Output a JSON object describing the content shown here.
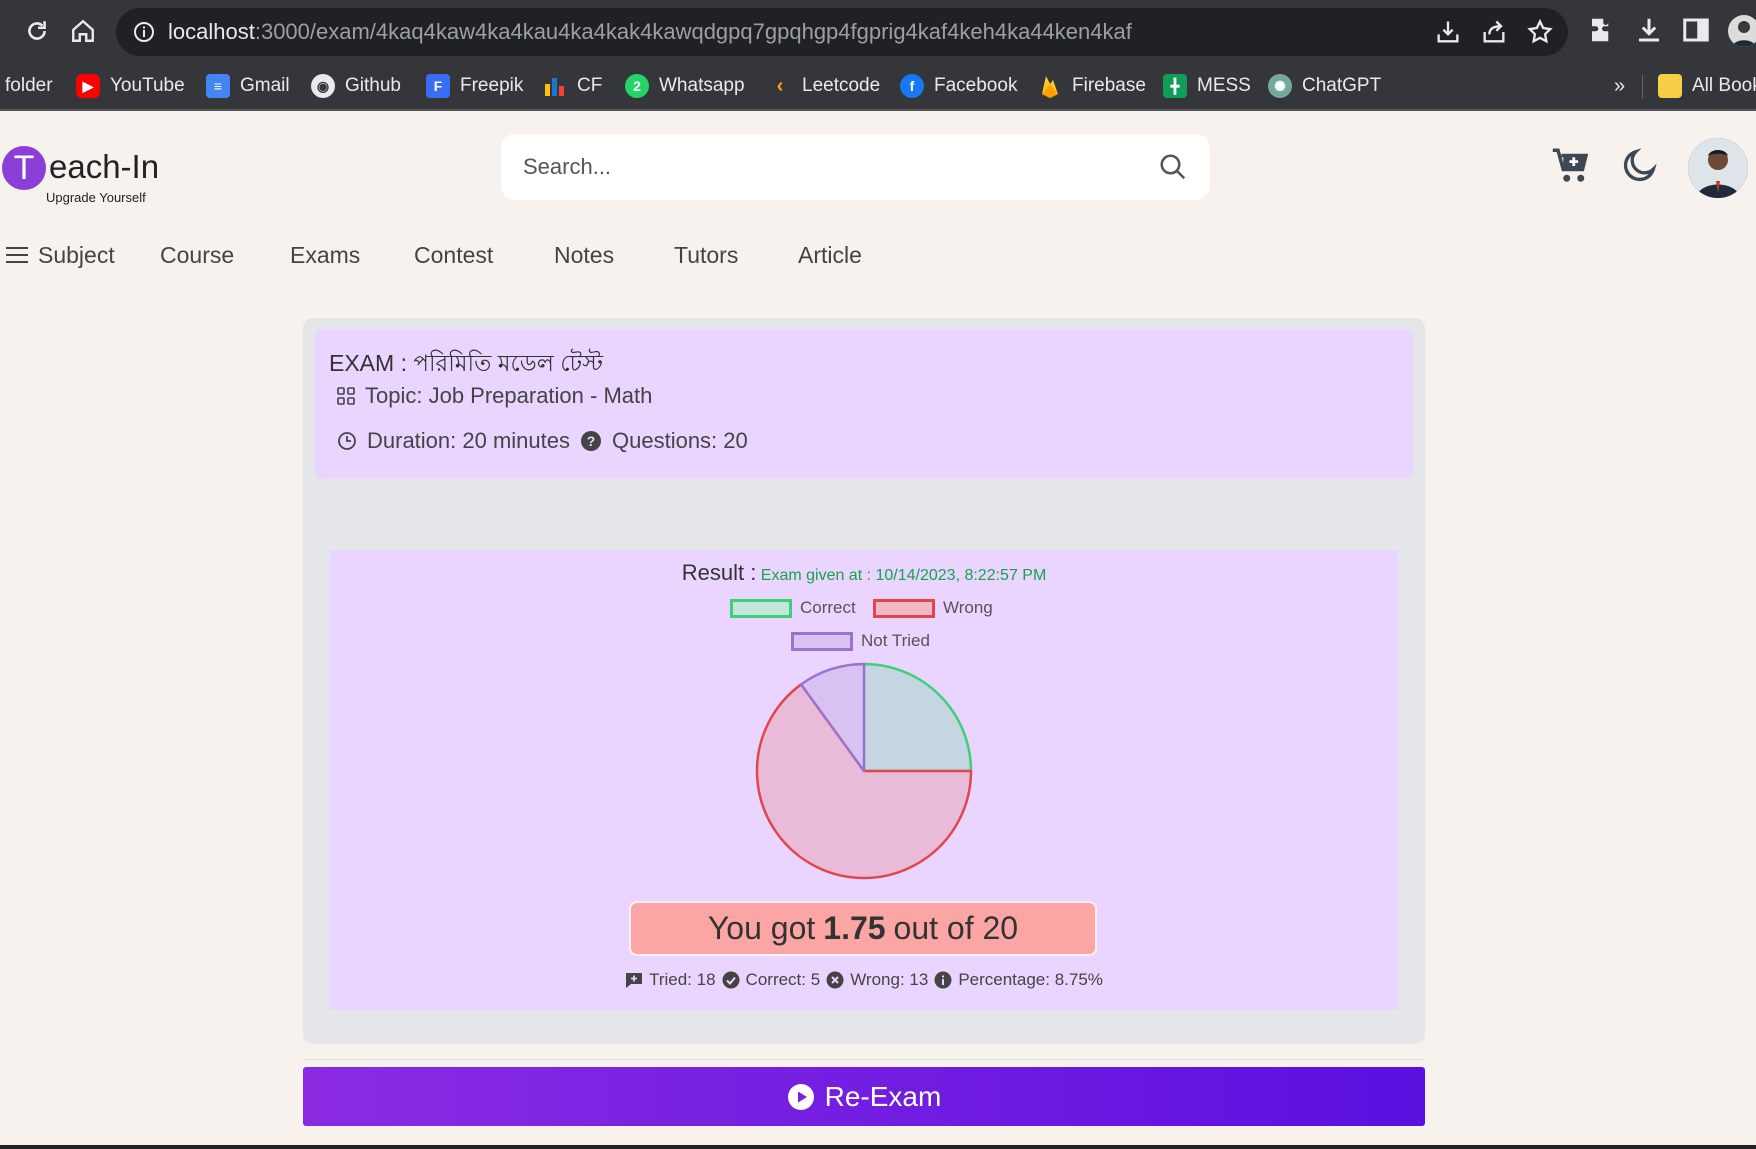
{
  "browser": {
    "url_host": "localhost",
    "url_path": ":3000/exam/4kaq4kaw4ka4kau4ka4kak4kawqdgpq7gpqhgp4fgprig4kaf4keh4ka44ken4kaf",
    "bookmarks": [
      {
        "label": "folder",
        "icon": "folder-icon"
      },
      {
        "label": "YouTube",
        "icon": "youtube-icon",
        "color": "#ff0000"
      },
      {
        "label": "Gmail",
        "icon": "docs-icon",
        "color": "#4285f4"
      },
      {
        "label": "Github",
        "icon": "github-icon",
        "color": "#e8eaed"
      },
      {
        "label": "Freepik",
        "icon": "freepik-icon",
        "color": "#3b6cf6"
      },
      {
        "label": "CF",
        "icon": "codeforces-icon"
      },
      {
        "label": "Whatsapp",
        "icon": "whatsapp-icon",
        "color": "#25d366"
      },
      {
        "label": "Leetcode",
        "icon": "leetcode-icon",
        "color": "#ffa116"
      },
      {
        "label": "Facebook",
        "icon": "facebook-icon",
        "color": "#1877f2"
      },
      {
        "label": "Firebase",
        "icon": "firebase-icon",
        "color": "#ffca28"
      },
      {
        "label": "MESS",
        "icon": "sheets-icon",
        "color": "#0f9d58"
      },
      {
        "label": "ChatGPT",
        "icon": "chatgpt-icon",
        "color": "#74aa9c"
      }
    ],
    "more_bookmarks": "»",
    "all_bookmarks": "All Book"
  },
  "site": {
    "logo_letter": "T",
    "logo_text": "each-In",
    "tagline": "Upgrade Yourself",
    "search_placeholder": "Search...",
    "nav": [
      "Subject",
      "Course",
      "Exams",
      "Contest",
      "Notes",
      "Tutors",
      "Article"
    ]
  },
  "exam": {
    "title": "EXAM : পরিমিতি মডেল টেস্ট",
    "topic": "Topic: Job Preparation - Math",
    "duration": "Duration: 20 minutes",
    "questions": "Questions: 20"
  },
  "result": {
    "label": "Result :",
    "given_at": "Exam given at : 10/14/2023, 8:22:57 PM",
    "score_prefix": "You got",
    "score_value": "1.75",
    "score_suffix": "out of 20",
    "tried": "Tried: 18",
    "correct": "Correct: 5",
    "wrong": "Wrong: 13",
    "percentage": "Percentage: 8.75%",
    "reexam_label": "Re-Exam"
  },
  "chart_data": {
    "type": "pie",
    "labels": [
      "Correct",
      "Wrong",
      "Not Tried"
    ],
    "values": [
      5,
      13,
      2
    ],
    "colors": {
      "Correct": {
        "fill": "#c5d6e2",
        "stroke": "#3ecf7a"
      },
      "Wrong": {
        "fill": "#e9bbd9",
        "stroke": "#e0474c"
      },
      "Not Tried": {
        "fill": "#d8c2f2",
        "stroke": "#9b72cf"
      }
    },
    "legend_position": "top"
  }
}
